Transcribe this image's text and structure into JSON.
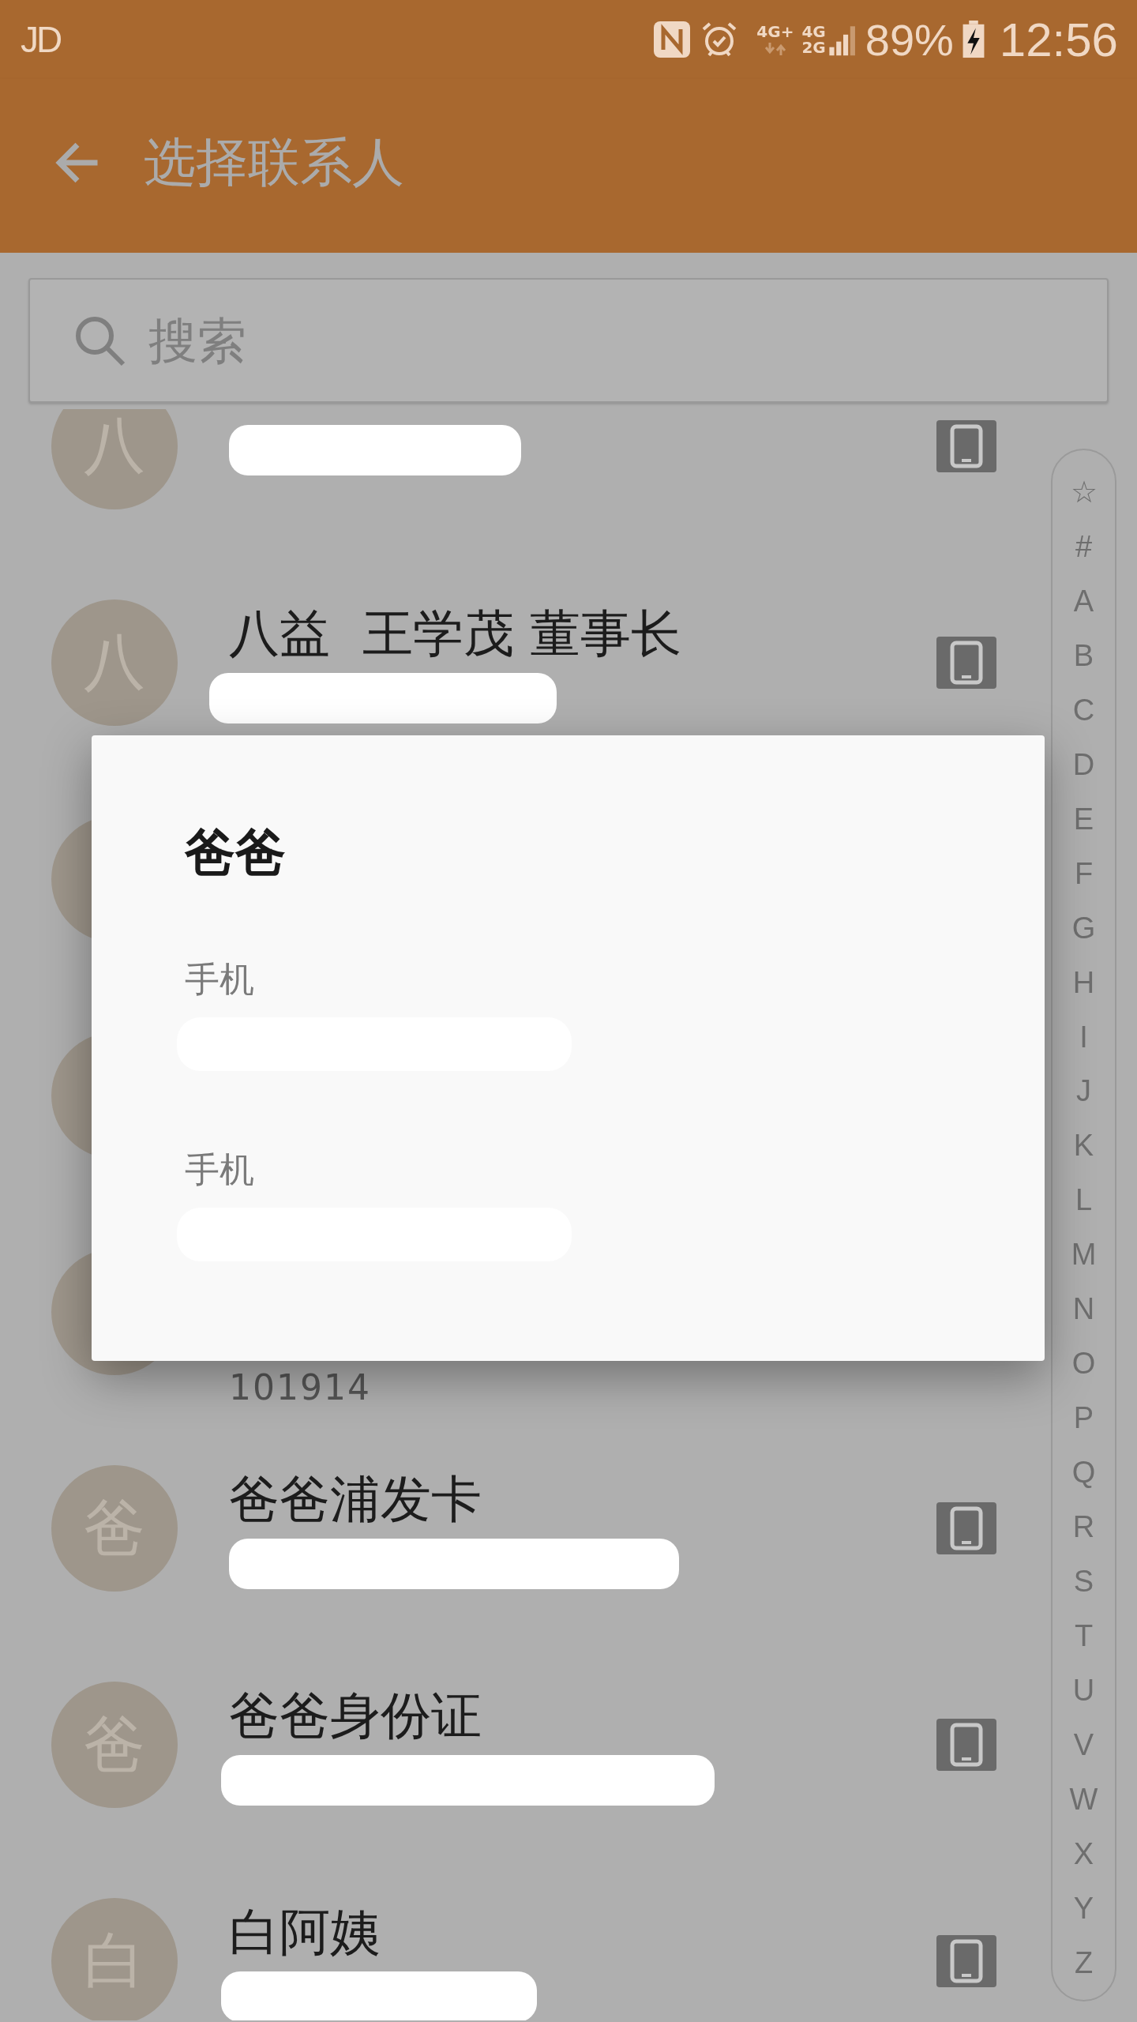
{
  "status_bar": {
    "notification": "JD",
    "network_primary": "4G+",
    "network_secondary_top": "4G",
    "network_secondary_bottom": "2G",
    "battery": "89%",
    "time": "12:56"
  },
  "toolbar": {
    "title": "选择联系人"
  },
  "search": {
    "placeholder": "搜索"
  },
  "contacts": [
    {
      "kind": "contact",
      "avatar": "八"
    },
    {
      "kind": "contact",
      "avatar": "八",
      "name": "八益  王学茂 董事长"
    },
    {
      "kind": "contact"
    },
    {
      "kind": "contact"
    },
    {
      "kind": "contact",
      "number": "101914"
    },
    {
      "kind": "contact",
      "avatar": "爸",
      "name": "爸爸浦发卡"
    },
    {
      "kind": "contact",
      "avatar": "爸",
      "name": "爸爸身份证"
    },
    {
      "kind": "contact",
      "avatar": "白",
      "name": "白阿姨"
    }
  ],
  "index_bar": [
    "☆",
    "#",
    "A",
    "B",
    "C",
    "D",
    "E",
    "F",
    "G",
    "H",
    "I",
    "J",
    "K",
    "L",
    "M",
    "N",
    "O",
    "P",
    "Q",
    "R",
    "S",
    "T",
    "U",
    "V",
    "W",
    "X",
    "Y",
    "Z"
  ],
  "dialog": {
    "title": "爸爸",
    "entries": [
      {
        "label": "手机"
      },
      {
        "label": "手机"
      }
    ]
  }
}
